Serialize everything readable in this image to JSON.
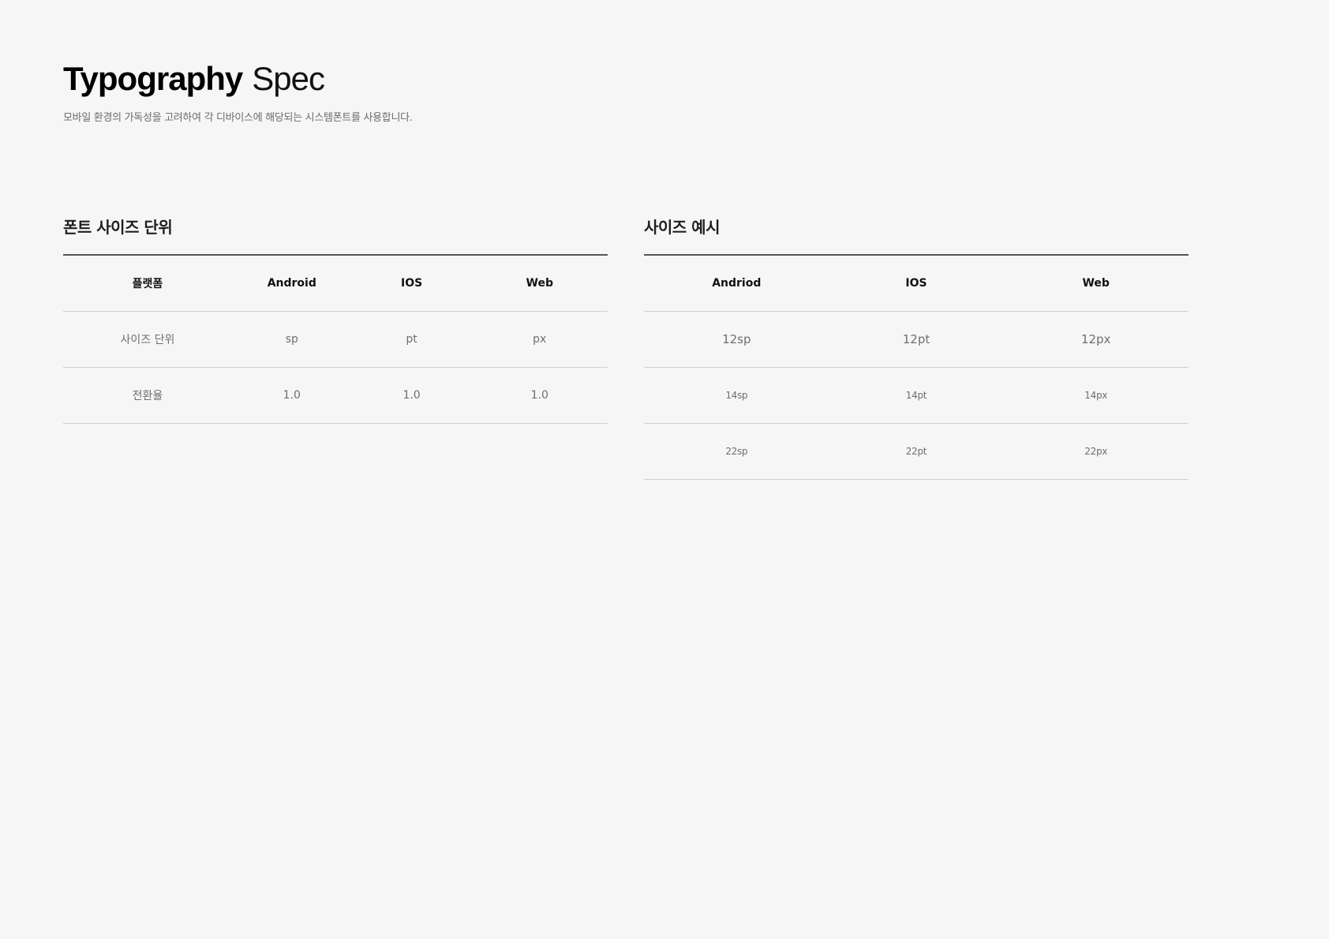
{
  "header": {
    "title_bold": "Typography",
    "title_light": "Spec",
    "subtitle": "모바일 환경의 가독성을 고려하여 각 디바이스에 해당되는 시스템폰트를 사용합니다."
  },
  "unit_section": {
    "title": "폰트 사이즈 단위",
    "headers": [
      "플랫폼",
      "Android",
      "IOS",
      "Web"
    ],
    "rows": [
      [
        "사이즈 단위",
        "sp",
        "pt",
        "px"
      ],
      [
        "전환율",
        "1.0",
        "1.0",
        "1.0"
      ]
    ]
  },
  "example_section": {
    "title": "사이즈 예시",
    "headers": [
      "Andriod",
      "IOS",
      "Web"
    ],
    "rows": [
      [
        "12sp",
        "12pt",
        "12px"
      ],
      [
        "14sp",
        "14pt",
        "14px"
      ],
      [
        "22sp",
        "22pt",
        "22px"
      ]
    ]
  }
}
